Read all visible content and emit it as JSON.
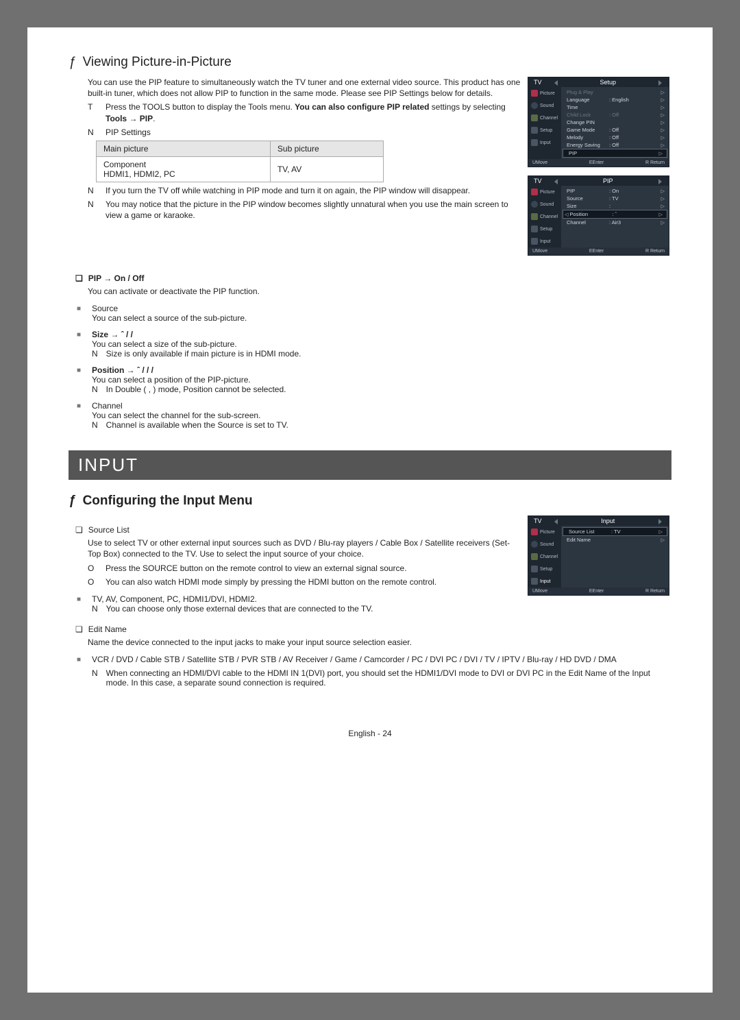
{
  "pip": {
    "section_title": "Viewing Picture-in-Picture",
    "intro": "You can use the PIP feature to simultaneously watch the TV tuner and one external video source. This product has one built-in tuner, which does not allow PIP to function in the same mode. Please see  PIP Settings  below for details.",
    "note_T": "Press the TOOLS button to display the Tools  menu. You can also configure PIP related settings by selecting Tools → PIP.",
    "note_settings_label": "PIP Settings",
    "table": {
      "header_main": "Main picture",
      "header_sub": "Sub picture",
      "cell_main": "Component\nHDMI1, HDMI2, PC",
      "cell_sub": "TV, AV"
    },
    "note_off": "If you turn the TV off while watching in PIP mode and turn it on again, the PIP window will disappear.",
    "note_unnatural": "You may notice that the picture in the PIP window becomes slightly unnatural when you use the main screen to view a game or karaoke.",
    "pip_onoff_head": "PIP → On / Off",
    "pip_onoff_desc": "You can activate or deactivate the PIP function.",
    "source_head": "Source",
    "source_desc": "You can select a source of the sub-picture.",
    "size_head": "Size → ˆ /    /",
    "size_desc": "You can select a size of the sub-picture.",
    "size_note": "Size  is only available if main picture is in HDMI mode.",
    "position_head": "Position → ˆ /   /   /",
    "position_desc": "You can select a position of the PIP-picture.",
    "position_note": "In Double ( ,  ) mode, Position         cannot be selected.",
    "channel_head": "Channel",
    "channel_desc": "You can select the channel for the sub-screen.",
    "channel_note": "Channel is available when the  Source is set to  TV."
  },
  "input": {
    "banner": "Input",
    "config_title": "Configuring the Input Menu",
    "source_list_head": "Source List",
    "source_list_desc": "Use to select TV or other external input sources such as DVD / Blu-ray players / Cable Box / Satellite receivers (Set-Top Box) connected to the TV. Use to select the input source of your choice.",
    "source_o1": "Press the SOURCE button on the remote control to view an external signal source.",
    "source_o2": "You can also watch HDMI mode simply by pressing the HDMI button on the remote control.",
    "devices": "TV, AV, Component, PC, HDMI1/DVI, HDMI2.",
    "devices_note": "You can choose only those external devices that are connected to the TV.",
    "edit_name_head": "Edit Name",
    "edit_name_desc": "Name the device connected to the input jacks to make your input source selection easier.",
    "edit_devices": "VCR / DVD / Cable STB / Satellite STB / PVR STB / AV Receiver / Game / Camcorder / PC / DVI PC / DVI / TV / IPTV / Blu-ray / HD DVD / DMA",
    "edit_note": "When connecting an HDMI/DVI cable to the HDMI IN 1(DVI) port, you should set the HDMI1/DVI mode to DVI or DVI PC in the Edit Name of the Input   mode. In this case, a separate sound connection is required."
  },
  "osd_setup": {
    "tv": "TV",
    "title": "Setup",
    "side": [
      "Picture",
      "Sound",
      "Channel",
      "Setup",
      "Input"
    ],
    "rows": [
      {
        "k": "Plug & Play",
        "v": "",
        "dim": true
      },
      {
        "k": "Language",
        "v": ": English"
      },
      {
        "k": "Time",
        "v": ""
      },
      {
        "k": "Child Lock",
        "v": ": Off",
        "dim": true
      },
      {
        "k": "Change PIN",
        "v": ""
      },
      {
        "k": "Game Mode",
        "v": ": Off"
      },
      {
        "k": "Melody",
        "v": ": Off"
      },
      {
        "k": "Energy Saving",
        "v": ": Off"
      },
      {
        "k": "PIP",
        "v": "",
        "sel": true
      }
    ],
    "foot": {
      "move": "UMove",
      "enter": "EEnter",
      "ret": "R Return"
    }
  },
  "osd_pip": {
    "tv": "TV",
    "title": "PIP",
    "side": [
      "Picture",
      "Sound",
      "Channel",
      "Setup",
      "Input"
    ],
    "rows": [
      {
        "k": "PIP",
        "v": ": On"
      },
      {
        "k": "Source",
        "v": ": TV"
      },
      {
        "k": "Size",
        "v": ":"
      },
      {
        "k": "Position",
        "v": ": ˆ",
        "sel": true
      },
      {
        "k": "Channel",
        "v": ": Air3"
      }
    ],
    "foot": {
      "move": "UMove",
      "enter": "EEnter",
      "ret": "R Return"
    }
  },
  "osd_input": {
    "tv": "TV",
    "title": "Input",
    "side": [
      "Picture",
      "Sound",
      "Channel",
      "Setup",
      "Input"
    ],
    "rows": [
      {
        "k": "Source List",
        "v": ": TV",
        "sel": true
      },
      {
        "k": "Edit Name",
        "v": ""
      }
    ],
    "foot": {
      "move": "UMove",
      "enter": "EEnter",
      "ret": "R Return"
    }
  },
  "footer": "English - 24"
}
